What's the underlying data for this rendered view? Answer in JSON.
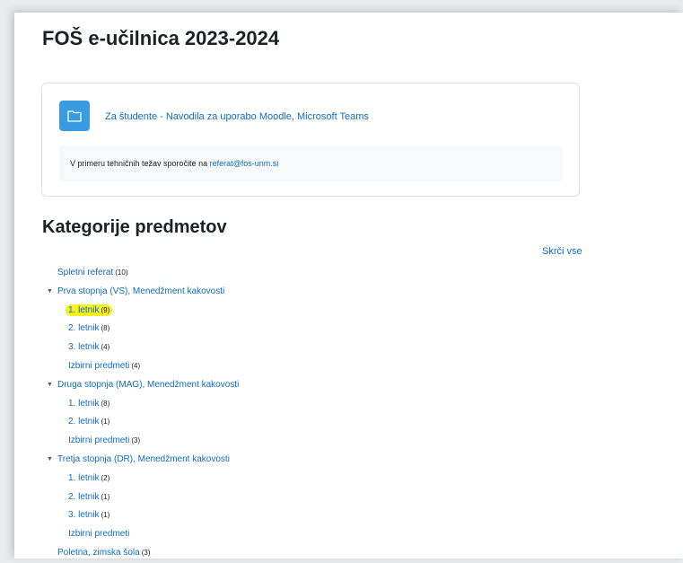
{
  "site": {
    "title": "FOŠ e-učilnica 2023-2024"
  },
  "info_card": {
    "activity": {
      "icon": "folder-icon",
      "label": "Za študente - Navodila za uporabo Moodle, Microsoft Teams"
    },
    "note": {
      "text": "V primeru tehničnih težav sporočite na ",
      "email": "referat@fos-unm.si"
    }
  },
  "categories": {
    "heading": "Kategorije predmetov",
    "collapse_label": "Skrči vse",
    "items": [
      {
        "label": "Spletni referat",
        "count": "(10)"
      },
      {
        "label": "Prva stopnja (VS), Menedžment kakovosti"
      },
      {
        "label": "1. letnik",
        "count": "(9)"
      },
      {
        "label": "2. letnik",
        "count": "(8)"
      },
      {
        "label": "3. letnik",
        "count": "(4)"
      },
      {
        "label": "Izbirni predmeti",
        "count": "(4)"
      },
      {
        "label": "Druga stopnja (MAG), Menedžment kakovosti"
      },
      {
        "label": "1. letnik",
        "count": "(8)"
      },
      {
        "label": "2. letnik",
        "count": "(1)"
      },
      {
        "label": "Izbirni predmeti",
        "count": "(3)"
      },
      {
        "label": "Tretja stopnja (DR), Menedžment kakovosti"
      },
      {
        "label": "1. letnik",
        "count": "(2)"
      },
      {
        "label": "2. letnik",
        "count": "(1)"
      },
      {
        "label": "3. letnik",
        "count": "(1)"
      },
      {
        "label": "Izbirni predmeti"
      },
      {
        "label": "Poletna, zimska šola",
        "count": "(3)"
      }
    ]
  },
  "colors": {
    "link": "#0f6cbf",
    "folder_tile": "#399be2",
    "highlight": "#f6f020"
  }
}
